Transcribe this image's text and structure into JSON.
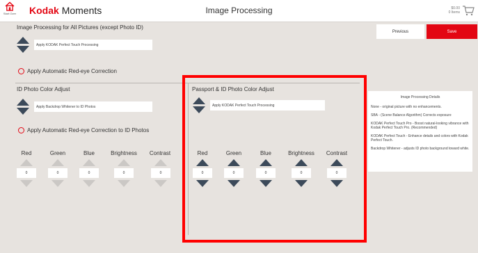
{
  "header": {
    "start_over_label": "Start Over",
    "brand_kodak": "Kodak",
    "brand_moments": "Moments",
    "page_title": "Image Processing",
    "cart_amount": "$0.00",
    "cart_items": "0 Items"
  },
  "buttons": {
    "previous": "Previous",
    "save": "Save"
  },
  "all_pictures": {
    "title": "Image Processing for All Pictures (except Photo ID)",
    "dropdown_value": "Apply KODAK Perfect Touch Processing",
    "redeye_label": "Apply Automatic Red-eye Correction"
  },
  "id_photo": {
    "title": "ID Photo Color Adjust",
    "dropdown_value": "Apply Backdrop Whitener to ID Photos",
    "redeye_label": "Apply Automatic Red-eye Correction to ID Photos",
    "adjustments": [
      {
        "label": "Red",
        "value": "0"
      },
      {
        "label": "Green",
        "value": "0"
      },
      {
        "label": "Blue",
        "value": "0"
      },
      {
        "label": "Brightness",
        "value": "0"
      },
      {
        "label": "Contrast",
        "value": "0"
      }
    ]
  },
  "passport": {
    "title": "Passport & ID Photo Color Adjust",
    "dropdown_value": "Apply KODAK Perfect Touch Processing",
    "adjustments": [
      {
        "label": "Red",
        "value": "0"
      },
      {
        "label": "Green",
        "value": "0"
      },
      {
        "label": "Blue",
        "value": "0"
      },
      {
        "label": "Brightness",
        "value": "0"
      },
      {
        "label": "Contrast",
        "value": "0"
      }
    ]
  },
  "details": {
    "title": "Image Processing Details",
    "items": [
      "None - original picture with no enhancements.",
      "SBA - (Scene Balance Algorithm) Corrects exposure",
      "KODAK Perfect Touch Pro - Boost natural-looking vibrance with Kodak Perfect Touch Pro. (Recommended)",
      "KODAK Perfect Touch - Enhance details and colors with Kodak Perfect Touch.",
      "Backdrop Whitener - adjusts ID photo background toward white."
    ]
  },
  "colors": {
    "accent": "#e30613",
    "arrow": "#3c4a5a",
    "arrow_disabled": "#cbc8c5",
    "highlight": "#ff0000",
    "background": "#e7e3df"
  },
  "icons": {
    "start_over": "home-icon",
    "cart": "cart-icon"
  }
}
